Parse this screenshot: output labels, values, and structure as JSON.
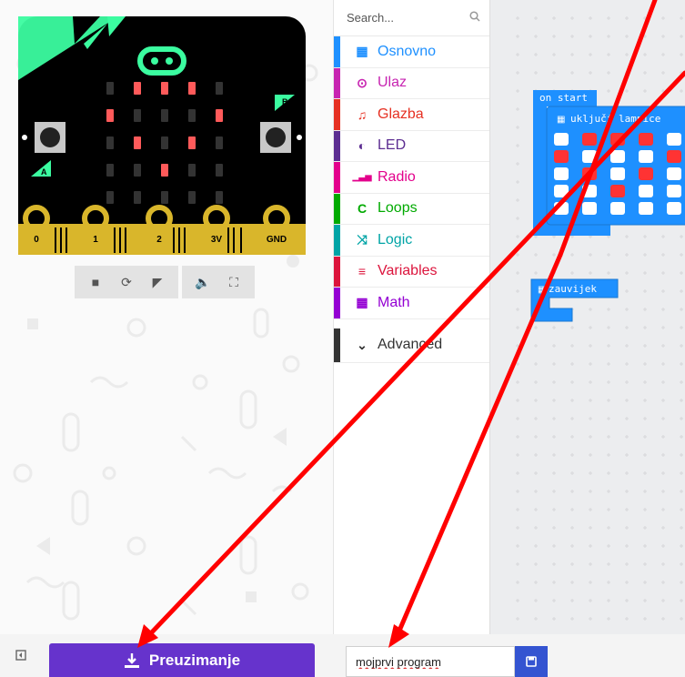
{
  "simulator": {
    "pins": [
      "0",
      "1",
      "2",
      "3V",
      "GND"
    ],
    "button_a": "A",
    "button_b": "B",
    "led_matrix": [
      [
        0,
        1,
        1,
        1,
        0
      ],
      [
        1,
        0,
        0,
        0,
        1
      ],
      [
        0,
        1,
        0,
        1,
        0
      ],
      [
        0,
        0,
        1,
        0,
        0
      ],
      [
        0,
        0,
        0,
        0,
        0
      ]
    ],
    "toolbar": [
      "stop-icon",
      "restart-icon",
      "debug-icon",
      "mute-icon",
      "fullscreen-icon"
    ]
  },
  "toolbox": {
    "search_placeholder": "Search...",
    "categories": [
      {
        "label": "Osnovno",
        "icon": "grid-icon",
        "glyph": "▦",
        "color": "#1e90ff"
      },
      {
        "label": "Ulaz",
        "icon": "target-icon",
        "glyph": "⊙",
        "color": "#c724b1"
      },
      {
        "label": "Glazba",
        "icon": "headphones-icon",
        "glyph": "♫",
        "color": "#e63022"
      },
      {
        "label": "LED",
        "icon": "toggle-icon",
        "glyph": "◐",
        "color": "#5c2d91"
      },
      {
        "label": "Radio",
        "icon": "signal-icon",
        "glyph": "▁▃▅",
        "color": "#e3008c"
      },
      {
        "label": "Loops",
        "icon": "loop-icon",
        "glyph": "C",
        "color": "#00aa00"
      },
      {
        "label": "Logic",
        "icon": "shuffle-icon",
        "glyph": "⤨",
        "color": "#00a4a6"
      },
      {
        "label": "Variables",
        "icon": "list-icon",
        "glyph": "≡",
        "color": "#dc143c"
      },
      {
        "label": "Math",
        "icon": "calculator-icon",
        "glyph": "▦",
        "color": "#9400d3"
      }
    ],
    "advanced": {
      "label": "Advanced",
      "icon": "chevron-down-icon",
      "color": "#333333"
    }
  },
  "workspace": {
    "on_start_label": "on start",
    "show_leds_label": "uključi lampice",
    "forever_label": "zauvijek",
    "block_color": "#1e90ff",
    "led_on_color": "#ff3333",
    "led_off_color": "#ffffff",
    "show_leds_grid": [
      [
        0,
        1,
        1,
        1,
        0
      ],
      [
        1,
        0,
        0,
        0,
        1
      ],
      [
        0,
        1,
        0,
        1,
        0
      ],
      [
        0,
        0,
        1,
        0,
        0
      ],
      [
        0,
        0,
        0,
        0,
        0
      ]
    ]
  },
  "bottom": {
    "download_label": "Preuzimanje",
    "project_name": "mojprvi program",
    "accent_color": "#6633cc",
    "save_color": "#3454d1"
  }
}
